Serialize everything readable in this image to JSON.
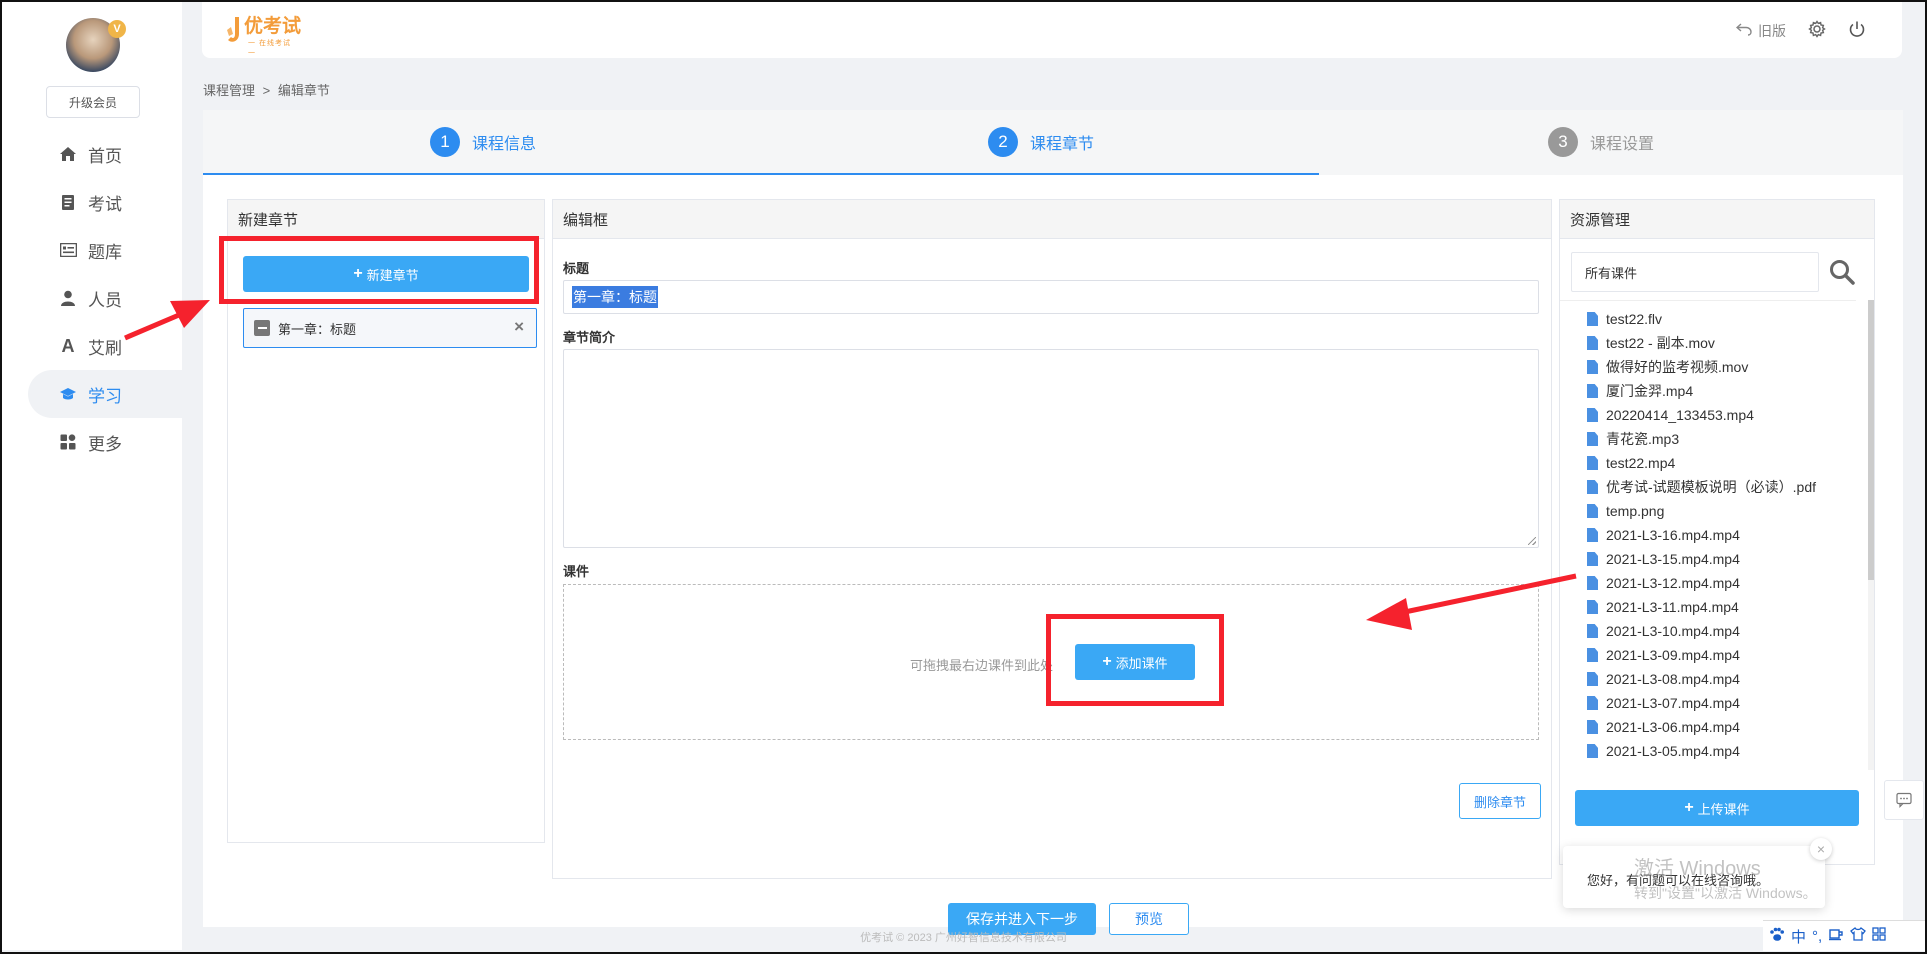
{
  "sidebar": {
    "upgrade_label": "升级会员",
    "items": [
      {
        "label": "首页",
        "icon": "home-icon",
        "active": false
      },
      {
        "label": "考试",
        "icon": "exam-icon",
        "active": false
      },
      {
        "label": "题库",
        "icon": "question-bank-icon",
        "active": false
      },
      {
        "label": "人员",
        "icon": "user-icon",
        "active": false
      },
      {
        "label": "艾刷",
        "icon": "brush-letter-icon",
        "active": false
      },
      {
        "label": "学习",
        "icon": "graduation-cap-icon",
        "active": true
      },
      {
        "label": "更多",
        "icon": "grid-icon",
        "active": false
      }
    ]
  },
  "topbar": {
    "logo_text": "优考试",
    "logo_sub": "一 在线考试 一",
    "old_version_label": "旧版"
  },
  "breadcrumb": {
    "root": "课程管理",
    "separator": ">",
    "current": "编辑章节"
  },
  "steps": [
    {
      "num": "1",
      "label": "课程信息",
      "state": "done"
    },
    {
      "num": "2",
      "label": "课程章节",
      "state": "active"
    },
    {
      "num": "3",
      "label": "课程设置",
      "state": "pending"
    }
  ],
  "chapters_panel": {
    "title": "新建章节",
    "new_button": "新建章节",
    "items": [
      {
        "label": "第一章：标题"
      }
    ]
  },
  "editor": {
    "title": "编辑框",
    "title_label": "标题",
    "title_value": "第一章：标题",
    "intro_label": "章节简介",
    "intro_value": "",
    "courseware_label": "课件",
    "drop_hint": "可拖拽最右边课件到此处",
    "add_button": "添加课件",
    "delete_button": "删除章节"
  },
  "resources": {
    "title": "资源管理",
    "search_value": "所有课件",
    "files": [
      "test22.flv",
      "test22 - 副本.mov",
      "做得好的监考视频.mov",
      "厦门金羿.mp4",
      "20220414_133453.mp4",
      "青花瓷.mp3",
      "test22.mp4",
      "优考试-试题模板说明（必读）.pdf",
      "temp.png",
      "2021-L3-16.mp4.mp4",
      "2021-L3-15.mp4.mp4",
      "2021-L3-12.mp4.mp4",
      "2021-L3-11.mp4.mp4",
      "2021-L3-10.mp4.mp4",
      "2021-L3-09.mp4.mp4",
      "2021-L3-08.mp4.mp4",
      "2021-L3-07.mp4.mp4",
      "2021-L3-06.mp4.mp4",
      "2021-L3-05.mp4.mp4"
    ],
    "upload_button": "上传课件"
  },
  "bottom": {
    "save_next": "保存并进入下一步",
    "preview": "预览",
    "copyright": "优考试 © 2023 广州好智信息技术有限公司"
  },
  "chat": {
    "message": "您好，有问题可以在线咨询哦。"
  },
  "watermark": {
    "line1": "激活 Windows",
    "line2": "转到\"设置\"以激活 Windows。"
  },
  "tray": {
    "ime": "中"
  },
  "colors": {
    "primary": "#2d8cf0",
    "button": "#3aa8f5",
    "annotation": "#f5222d",
    "logo": "#f39c3a"
  }
}
